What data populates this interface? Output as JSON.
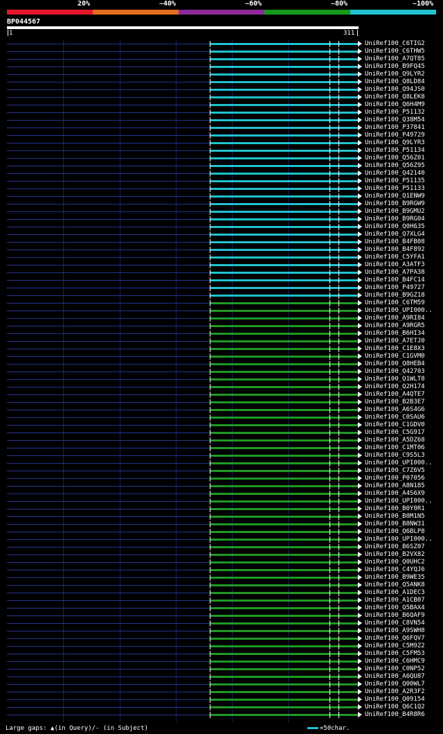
{
  "scale": {
    "labels": [
      "20%",
      "~40%",
      "~60%",
      "~80%",
      "~100%"
    ],
    "colors": [
      "#e8162b",
      "#e2701c",
      "#8e2b9b",
      "#14991d",
      "#1fc2cf"
    ]
  },
  "query": {
    "name": "BP044567",
    "start": "1",
    "end": "311"
  },
  "colors": {
    "cyan": "#1fc2cf",
    "green": "#1f9a24",
    "low": "#24358f"
  },
  "hits": [
    {
      "label": "UniRef100_C6TIG2",
      "color": "cyan"
    },
    {
      "label": "UniRef100_C6THW5",
      "color": "cyan"
    },
    {
      "label": "UniRef100_A7QT85",
      "color": "cyan"
    },
    {
      "label": "UniRef100_B9FQ45",
      "color": "cyan"
    },
    {
      "label": "UniRef100_Q9LYR2",
      "color": "cyan"
    },
    {
      "label": "UniRef100_Q8LD84",
      "color": "cyan"
    },
    {
      "label": "UniRef100_Q94JS0",
      "color": "cyan"
    },
    {
      "label": "UniRef100_Q8LEK8",
      "color": "cyan"
    },
    {
      "label": "UniRef100_Q6H4M9",
      "color": "cyan"
    },
    {
      "label": "UniRef100_P51132",
      "color": "cyan"
    },
    {
      "label": "UniRef100_Q38M54",
      "color": "cyan"
    },
    {
      "label": "UniRef100_P37841",
      "color": "cyan"
    },
    {
      "label": "UniRef100_P49729",
      "color": "cyan"
    },
    {
      "label": "UniRef100_Q9LYR3",
      "color": "cyan"
    },
    {
      "label": "UniRef100_P51134",
      "color": "cyan"
    },
    {
      "label": "UniRef100_Q56Z01",
      "color": "cyan"
    },
    {
      "label": "UniRef100_Q56Z95",
      "color": "cyan"
    },
    {
      "label": "UniRef100_Q42140",
      "color": "cyan"
    },
    {
      "label": "UniRef100_P51135",
      "color": "cyan"
    },
    {
      "label": "UniRef100_P51133",
      "color": "cyan"
    },
    {
      "label": "UniRef100_Q1ENW9",
      "color": "cyan"
    },
    {
      "label": "UniRef100_B9RGW9",
      "color": "cyan"
    },
    {
      "label": "UniRef100_B9GMU2",
      "color": "cyan"
    },
    {
      "label": "UniRef100_B9RG04",
      "color": "cyan"
    },
    {
      "label": "UniRef100_Q0H635",
      "color": "cyan"
    },
    {
      "label": "UniRef100_Q7XLG4",
      "color": "cyan"
    },
    {
      "label": "UniRef100_B4FB08",
      "color": "cyan"
    },
    {
      "label": "UniRef100_B4F892",
      "color": "cyan"
    },
    {
      "label": "UniRef100_C5YFA1",
      "color": "cyan"
    },
    {
      "label": "UniRef100_A3ATF3",
      "color": "cyan"
    },
    {
      "label": "UniRef100_A7PA38",
      "color": "cyan"
    },
    {
      "label": "UniRef100_B4FC14",
      "color": "cyan"
    },
    {
      "label": "UniRef100_P49727",
      "color": "cyan"
    },
    {
      "label": "UniRef100_B9GZ18",
      "color": "cyan"
    },
    {
      "label": "UniRef100_C6TM59",
      "color": "green"
    },
    {
      "label": "UniRef100_UPI000..",
      "color": "green"
    },
    {
      "label": "UniRef100_A9RI84",
      "color": "green"
    },
    {
      "label": "UniRef100_A9RGR5",
      "color": "green"
    },
    {
      "label": "UniRef100_B6HI34",
      "color": "green"
    },
    {
      "label": "UniRef100_A7ETJ0",
      "color": "green"
    },
    {
      "label": "UniRef100_C1E8X3",
      "color": "green"
    },
    {
      "label": "UniRef100_C1GVM0",
      "color": "green"
    },
    {
      "label": "UniRef100_Q8HEB4",
      "color": "green"
    },
    {
      "label": "UniRef100_Q42703",
      "color": "green"
    },
    {
      "label": "UniRef100_Q1WLT8",
      "color": "green"
    },
    {
      "label": "UniRef100_Q2H174",
      "color": "green"
    },
    {
      "label": "UniRef100_A4QTE7",
      "color": "green"
    },
    {
      "label": "UniRef100_B2B3E7",
      "color": "green"
    },
    {
      "label": "UniRef100_A6S4G6",
      "color": "green"
    },
    {
      "label": "UniRef100_C0SAU6",
      "color": "green"
    },
    {
      "label": "UniRef100_C1GDV0",
      "color": "green"
    },
    {
      "label": "UniRef100_C5G917",
      "color": "green"
    },
    {
      "label": "UniRef100_A5DZ68",
      "color": "green"
    },
    {
      "label": "UniRef100_C1MT06",
      "color": "green"
    },
    {
      "label": "UniRef100_C9S5L3",
      "color": "green"
    },
    {
      "label": "UniRef100_UPI000..",
      "color": "green"
    },
    {
      "label": "UniRef100_C7Z6V5",
      "color": "green"
    },
    {
      "label": "UniRef100_P07056",
      "color": "green"
    },
    {
      "label": "UniRef100_A8N185",
      "color": "green"
    },
    {
      "label": "UniRef100_A4S6X9",
      "color": "green"
    },
    {
      "label": "UniRef100_UPI000..",
      "color": "green"
    },
    {
      "label": "UniRef100_B0Y0R1",
      "color": "green"
    },
    {
      "label": "UniRef100_B8M1N5",
      "color": "green"
    },
    {
      "label": "UniRef100_B8NW31",
      "color": "green"
    },
    {
      "label": "UniRef100_Q6BLP8",
      "color": "green"
    },
    {
      "label": "UniRef100_UPI000..",
      "color": "green"
    },
    {
      "label": "UniRef100_B6SZ07",
      "color": "green"
    },
    {
      "label": "UniRef100_B2VX82",
      "color": "green"
    },
    {
      "label": "UniRef100_Q0UHC2",
      "color": "green"
    },
    {
      "label": "UniRef100_C4YQJ6",
      "color": "green"
    },
    {
      "label": "UniRef100_B9WE35",
      "color": "green"
    },
    {
      "label": "UniRef100_Q5ANK8",
      "color": "green"
    },
    {
      "label": "UniRef100_A1DEC3",
      "color": "green"
    },
    {
      "label": "UniRef100_A1CB07",
      "color": "green"
    },
    {
      "label": "UniRef100_Q5BAX4",
      "color": "green"
    },
    {
      "label": "UniRef100_B6QAF9",
      "color": "green"
    },
    {
      "label": "UniRef100_C8VN54",
      "color": "green"
    },
    {
      "label": "UniRef100_A9SWH8",
      "color": "green"
    },
    {
      "label": "UniRef100_Q6FQV7",
      "color": "green"
    },
    {
      "label": "UniRef100_C5M9Z2",
      "color": "green"
    },
    {
      "label": "UniRef100_C5FM53",
      "color": "green"
    },
    {
      "label": "UniRef100_C6HMC9",
      "color": "green"
    },
    {
      "label": "UniRef100_C0NP52",
      "color": "green"
    },
    {
      "label": "UniRef100_A6QU87",
      "color": "green"
    },
    {
      "label": "UniRef100_Q00WL7",
      "color": "green"
    },
    {
      "label": "UniRef100_A2R3F2",
      "color": "green"
    },
    {
      "label": "UniRef100_Q09154",
      "color": "green"
    },
    {
      "label": "UniRef100_Q6C1Q2",
      "color": "green"
    },
    {
      "label": "UniRef100_B4R8R6",
      "color": "green"
    }
  ],
  "footer": {
    "gaps": "Large gaps: ▲(in Query)/- (in Subject)",
    "legend": "=50char."
  }
}
